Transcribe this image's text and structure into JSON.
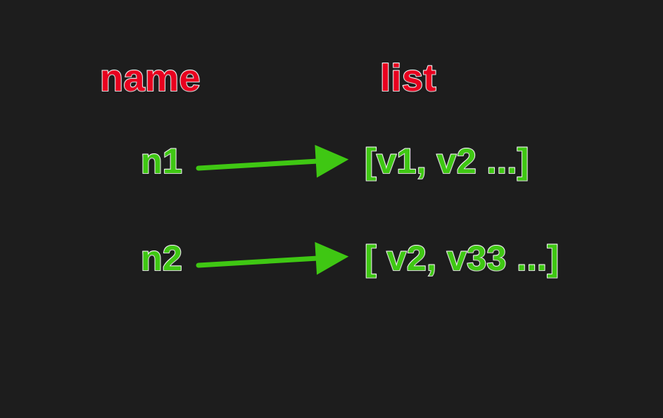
{
  "headers": {
    "name": "name",
    "list": "list"
  },
  "rows": [
    {
      "name": "n1",
      "list": "[v1, v2 ...]"
    },
    {
      "name": "n2",
      "list": "[ v2, v33 ...]"
    }
  ],
  "colors": {
    "header": "#e8001f",
    "value": "#3fc713",
    "arrow": "#3fc713",
    "outline": "#ffffff",
    "background": "#1d1d1d"
  }
}
